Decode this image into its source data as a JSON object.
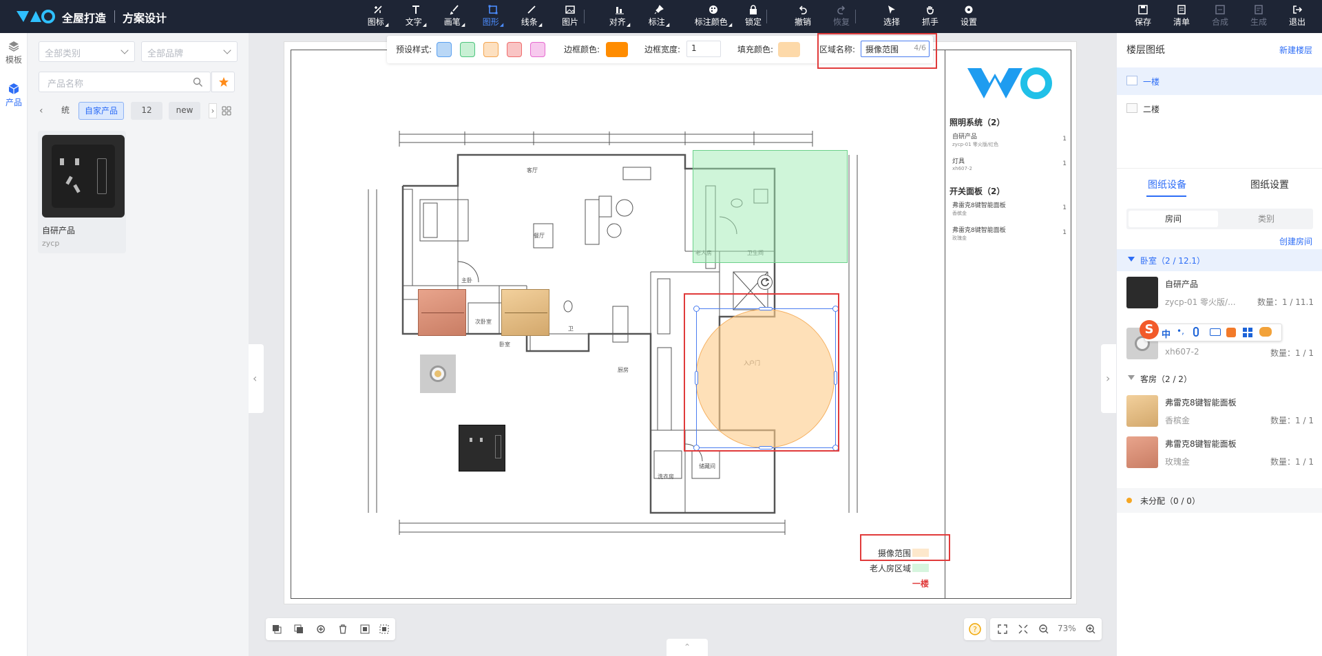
{
  "app": {
    "brand": "全屋打造",
    "subtitle": "方案设计"
  },
  "toolbar": {
    "tools": [
      {
        "label": "图标",
        "icon": "icon-tool-icon"
      },
      {
        "label": "文字",
        "icon": "text-tool-icon"
      },
      {
        "label": "画笔",
        "icon": "brush-tool-icon"
      },
      {
        "label": "图形",
        "icon": "shape-tool-icon",
        "active": true
      },
      {
        "label": "线条",
        "icon": "line-tool-icon"
      },
      {
        "label": "图片",
        "icon": "image-tool-icon"
      },
      {
        "label": "对齐",
        "icon": "align-tool-icon"
      },
      {
        "label": "标注",
        "icon": "pin-tool-icon"
      },
      {
        "label": "标注颜色",
        "icon": "palette-tool-icon"
      },
      {
        "label": "锁定",
        "icon": "lock-tool-icon"
      },
      {
        "label": "撤销",
        "icon": "undo-icon"
      },
      {
        "label": "恢复",
        "icon": "redo-icon",
        "disabled": true
      },
      {
        "label": "选择",
        "icon": "cursor-icon"
      },
      {
        "label": "抓手",
        "icon": "hand-icon"
      },
      {
        "label": "设置",
        "icon": "gear-icon"
      }
    ],
    "right_tools": [
      {
        "label": "保存",
        "icon": "save-icon"
      },
      {
        "label": "清单",
        "icon": "list-icon"
      },
      {
        "label": "合成",
        "icon": "merge-icon",
        "disabled": true
      },
      {
        "label": "生成",
        "icon": "generate-icon",
        "disabled": true
      },
      {
        "label": "退出",
        "icon": "exit-icon"
      }
    ]
  },
  "rail": {
    "items": [
      {
        "label": "模板"
      },
      {
        "label": "产品",
        "active": true
      }
    ]
  },
  "filters": {
    "category_placeholder": "全部类别",
    "brand_placeholder": "全部品牌",
    "search_placeholder": "产品名称",
    "tags": [
      "统",
      "自家产品",
      "12",
      "new"
    ]
  },
  "products": [
    {
      "name": "自研产品",
      "code": "zycp"
    }
  ],
  "props_bar": {
    "preset_label": "预设样式:",
    "preset_colors": [
      "#b9d7f6",
      "#c8f0d4",
      "#fde0c0",
      "#f9c4c4",
      "#f7c9ee"
    ],
    "preset_borders": [
      "#5aa0f0",
      "#4cc47d",
      "#f3a44e",
      "#ef6b6b",
      "#e66ad0"
    ],
    "border_color_label": "边框颜色:",
    "border_color": "#ff8c00",
    "border_width_label": "边框宽度:",
    "border_width_value": "1",
    "fill_color_label": "填充颜色:",
    "fill_color": "#fdd9a9",
    "area_name_label": "区域名称:",
    "area_name_value": "摄像范围",
    "area_name_count": "4/6"
  },
  "sheet_sidebar": {
    "sections": [
      {
        "title": "照明系统（2）",
        "items": [
          {
            "name": "自研产品",
            "sub": "zycp-01 零火版/红色",
            "qty": "1"
          },
          {
            "name": "灯具",
            "sub": "xh607-2",
            "qty": "1"
          }
        ]
      },
      {
        "title": "开关面板（2）",
        "items": [
          {
            "name": "弗雷克8键智能面板",
            "sub": "香槟金",
            "qty": "1"
          },
          {
            "name": "弗雷克8键智能面板",
            "sub": "玫瑰金",
            "qty": "1"
          }
        ]
      }
    ]
  },
  "legend": {
    "items": [
      {
        "label": "摄像范围",
        "color": "#fde8cc"
      },
      {
        "label": "老人房区域",
        "color": "#d6f5de"
      }
    ],
    "floor_label": "一楼"
  },
  "floorplan": {
    "rooms": [
      "次卧室",
      "老人房",
      "入户门",
      "主卧",
      "卫生间",
      "餐厅",
      "客厅",
      "卧室",
      "卫",
      "厨房",
      "洗衣房",
      "储藏间"
    ]
  },
  "right_panel": {
    "title": "楼层图纸",
    "new_floor": "新建楼层",
    "floors": [
      {
        "label": "一楼",
        "active": true
      },
      {
        "label": "二楼"
      }
    ],
    "tabs": [
      "图纸设备",
      "图纸设置"
    ],
    "seg": [
      "房间",
      "类别"
    ],
    "create_room": "创建房间",
    "groups": [
      {
        "title": "卧室（2 / 12.1）",
        "expanded": true,
        "items": [
          {
            "name": "自研产品",
            "sub": "zycp-01 零火版/...",
            "qty": "数量：1 / 11.1"
          },
          {
            "name": "",
            "sub": "xh607-2",
            "qty": "数量：1 / 1"
          }
        ]
      },
      {
        "title": "客房（2 / 2）",
        "expanded": false,
        "items": [
          {
            "name": "弗雷克8键智能面板",
            "sub": "香槟金",
            "qty": "数量：1 / 1"
          },
          {
            "name": "弗雷克8键智能面板",
            "sub": "玫瑰金",
            "qty": "数量：1 / 1"
          }
        ]
      }
    ],
    "unassigned": "未分配（0 / 0）"
  },
  "zoom": {
    "level": "73%"
  },
  "ime": {
    "label": "中"
  }
}
